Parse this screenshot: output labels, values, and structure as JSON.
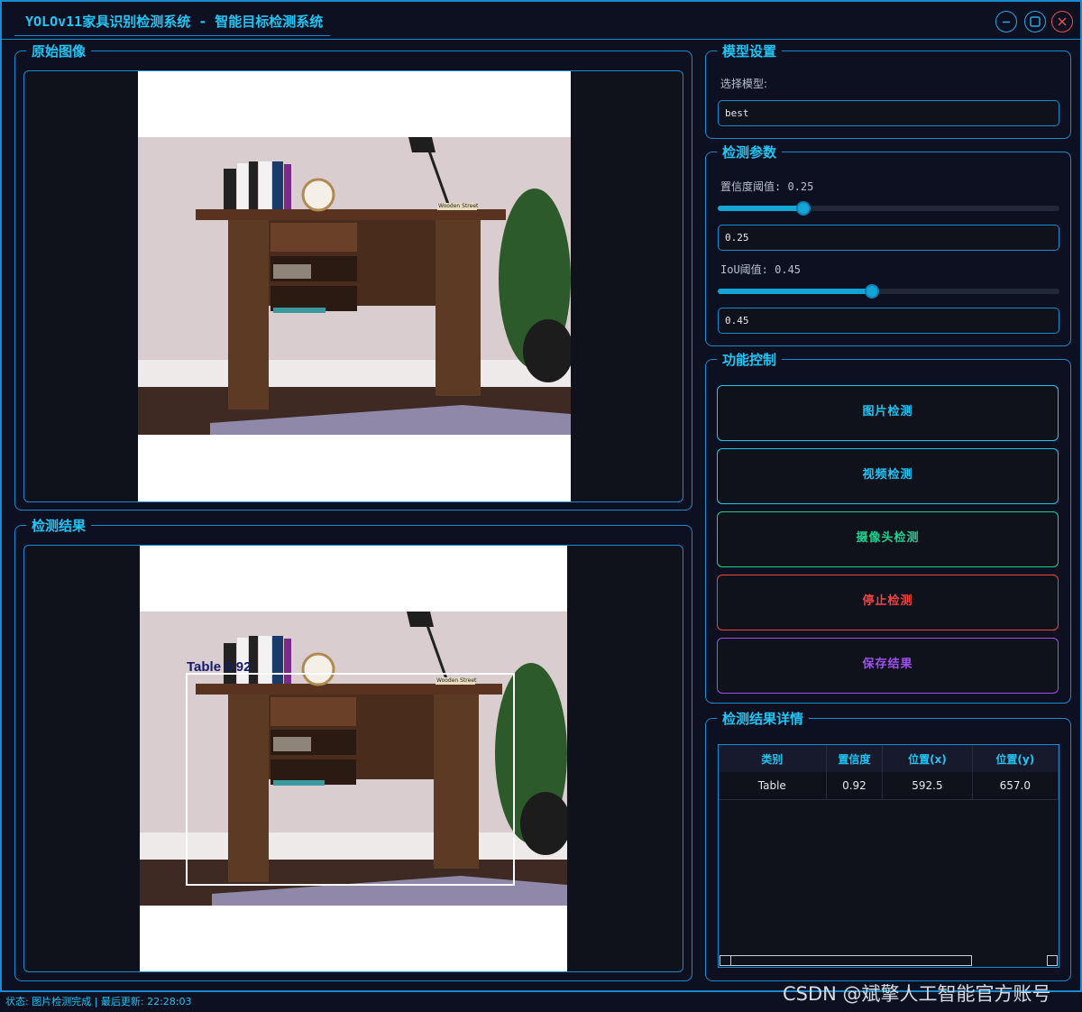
{
  "window": {
    "title": "YOLOv11家具识别检测系统 - 智能目标检测系统"
  },
  "panels": {
    "original": {
      "title": "原始图像"
    },
    "result": {
      "title": "检测结果"
    }
  },
  "detection_overlay": {
    "label": "Table 0.92",
    "box_color": "#ffffff",
    "label_color": "#141a6e"
  },
  "photo_text": {
    "sign": "Wooden Street"
  },
  "model_settings": {
    "title": "模型设置",
    "select_label": "选择模型:",
    "selected_model": "best"
  },
  "detection_params": {
    "title": "检测参数",
    "confidence": {
      "label": "置信度阈值: 0.25",
      "value": 0.25,
      "input": "0.25"
    },
    "iou": {
      "label": "IoU阈值: 0.45",
      "value": 0.45,
      "input": "0.45"
    }
  },
  "controls": {
    "title": "功能控制",
    "buttons": [
      {
        "label": "图片检测",
        "color": "#22c4f4"
      },
      {
        "label": "视频检测",
        "color": "#22c4f4"
      },
      {
        "label": "摄像头检测",
        "color": "#20d090"
      },
      {
        "label": "停止检测",
        "color": "#f04545"
      },
      {
        "label": "保存结果",
        "color": "#a050f0"
      }
    ]
  },
  "results_detail": {
    "title": "检测结果详情",
    "columns": [
      "类别",
      "置信度",
      "位置(x)",
      "位置(y)"
    ],
    "rows": [
      [
        "Table",
        "0.92",
        "592.5",
        "657.0"
      ]
    ]
  },
  "status": {
    "text": "状态: 图片检测完成 | 最后更新: 22:28:03"
  },
  "watermark": "CSDN @斌擎人工智能官方账号",
  "colors": {
    "accent": "#22c4f4",
    "border": "#1a8ad0",
    "background": "#0d1020"
  }
}
